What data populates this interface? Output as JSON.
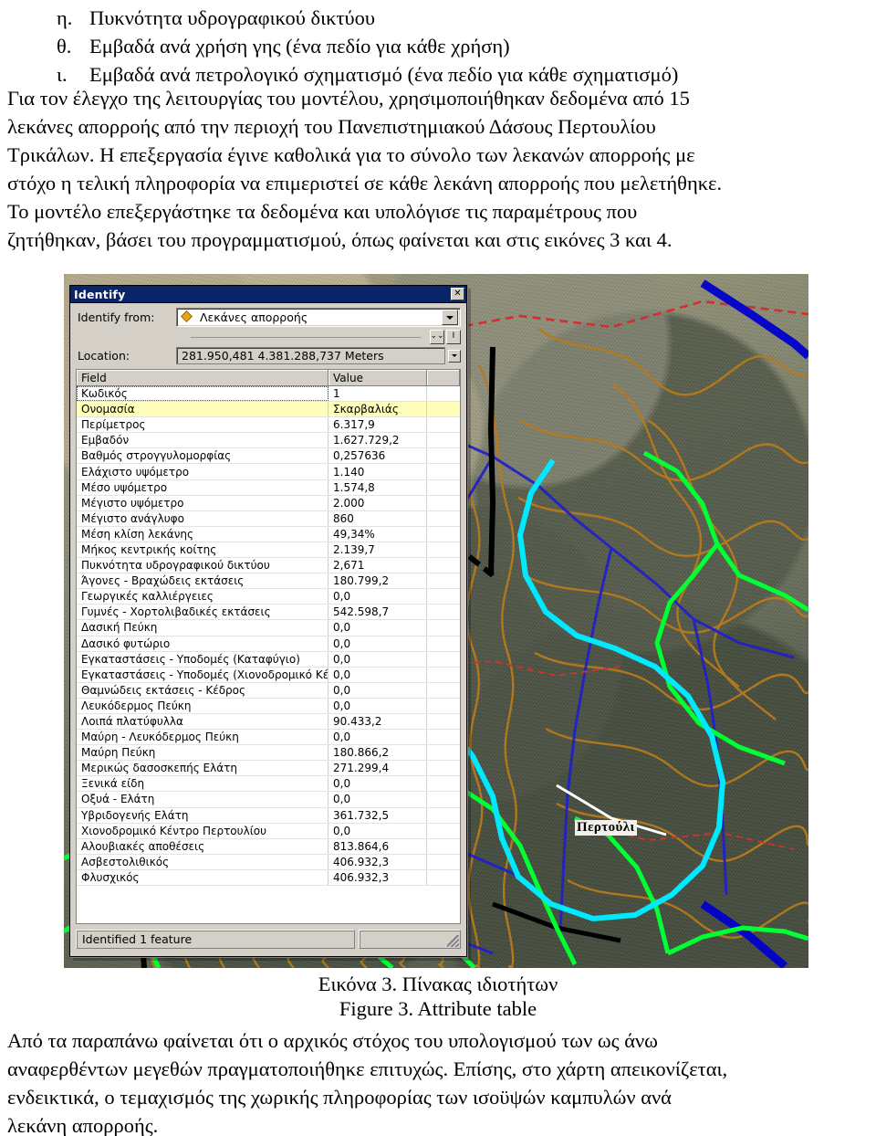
{
  "document": {
    "list_items": [
      {
        "marker": "η.",
        "text": "Πυκνότητα υδρογραφικού δικτύου"
      },
      {
        "marker": "θ.",
        "text": "Εμβαδά ανά χρήση γης (ένα πεδίο για κάθε χρήση)"
      },
      {
        "marker": "ι.",
        "text": "Εμβαδά ανά πετρολογικό σχηματισμό (ένα πεδίο για κάθε σχηματισμό)"
      }
    ],
    "paragraph_top_lines": [
      "Για τον έλεγχο της λειτουργίας του μοντέλου, χρησιμοποιήθηκαν δεδομένα από 15",
      "λεκάνες απορροής από την περιοχή του Πανεπιστημιακού Δάσους Περτουλίου",
      "Τρικάλων. Η επεξεργασία έγινε καθολικά για το σύνολο των λεκανών απορροής με",
      "στόχο η τελική πληροφορία να επιμεριστεί σε κάθε λεκάνη απορροής που μελετήθηκε.",
      "Το μοντέλο επεξεργάστηκε τα δεδομένα και υπολόγισε τις παραμέτρους που",
      "ζητήθηκαν, βάσει του προγραμματισμού, όπως φαίνεται και στις εικόνες 3 και 4."
    ],
    "caption_greek": "Εικόνα 3. Πίνακας ιδιοτήτων",
    "caption_english": "Figure 3. Attribute table",
    "paragraph_bottom_lines": [
      "Από τα παραπάνω φαίνεται ότι ο αρχικός στόχος του υπολογισμού των ως άνω",
      "αναφερθέντων μεγεθών πραγματοποιήθηκε επιτυχώς. Επίσης, στο χάρτη απεικονίζεται,",
      "ενδεικτικά, ο τεμαχισμός της χωρικής πληροφορίας των ισοϋψών καμπυλών ανά",
      "λεκάνη απορροής."
    ]
  },
  "map": {
    "label": "Περτούλι",
    "colors": {
      "contour": "#b8791a",
      "stream": "#2020c8",
      "basin_outline": "#00ff33",
      "selected_basin": "#00eaff",
      "road_black": "#000000",
      "road_red": "#d03030",
      "water_blue": "#0000cc"
    }
  },
  "dialog": {
    "title": "Identify",
    "close_label": "✕",
    "identify_from_label": "Identify from:",
    "identify_from_value": "Λεκάνες απορροής",
    "expand_button_label": "⌄⌄",
    "info_button_label": "I",
    "location_label": "Location:",
    "location_value": "281.950,481  4.381.288,737 Meters",
    "columns": [
      "Field",
      "Value",
      ""
    ],
    "rows": [
      {
        "field": "Κωδικός",
        "value": "1",
        "state": "selected"
      },
      {
        "field": "Ονομασία",
        "value": "Σκαρβαλιάς",
        "state": "highlight"
      },
      {
        "field": "Περίμετρος",
        "value": "6.317,9",
        "state": ""
      },
      {
        "field": "Εμβαδόν",
        "value": "1.627.729,2",
        "state": ""
      },
      {
        "field": "Βαθμός στρογγυλομορφίας",
        "value": "0,257636",
        "state": ""
      },
      {
        "field": "Ελάχιστο υψόμετρο",
        "value": "1.140",
        "state": ""
      },
      {
        "field": "Μέσο υψόμετρο",
        "value": "1.574,8",
        "state": ""
      },
      {
        "field": "Μέγιστο υψόμετρο",
        "value": "2.000",
        "state": ""
      },
      {
        "field": "Μέγιστο ανάγλυφο",
        "value": "860",
        "state": ""
      },
      {
        "field": "Μέση κλίση λεκάνης",
        "value": "49,34%",
        "state": ""
      },
      {
        "field": "Μήκος κεντρικής κοίτης",
        "value": "2.139,7",
        "state": ""
      },
      {
        "field": "Πυκνότητα υδρογραφικού δικτύου",
        "value": "2,671",
        "state": ""
      },
      {
        "field": "Άγονες - Βραχώδεις εκτάσεις",
        "value": "180.799,2",
        "state": ""
      },
      {
        "field": "Γεωργικές καλλιέργειες",
        "value": "0,0",
        "state": ""
      },
      {
        "field": "Γυμνές - Χορτολιβαδικές εκτάσεις",
        "value": "542.598,7",
        "state": ""
      },
      {
        "field": "Δασική Πεύκη",
        "value": "0,0",
        "state": ""
      },
      {
        "field": "Δασικό φυτώριο",
        "value": "0,0",
        "state": ""
      },
      {
        "field": "Εγκαταστάσεις - Υποδομές (Καταφύγιο)",
        "value": "0,0",
        "state": ""
      },
      {
        "field": "Εγκαταστάσεις - Υποδομές (Χιονοδρομικό Κέντρο)",
        "value": "0,0",
        "state": ""
      },
      {
        "field": "Θαμνώδεις εκτάσεις - Κέδρος",
        "value": "0,0",
        "state": ""
      },
      {
        "field": "Λευκόδερμος Πεύκη",
        "value": "0,0",
        "state": ""
      },
      {
        "field": "Λοιπά πλατύφυλλα",
        "value": "90.433,2",
        "state": ""
      },
      {
        "field": "Μαύρη - Λευκόδερμος Πεύκη",
        "value": "0,0",
        "state": ""
      },
      {
        "field": "Μαύρη Πεύκη",
        "value": "180.866,2",
        "state": ""
      },
      {
        "field": "Μερικώς δασοσκεπής Ελάτη",
        "value": "271.299,4",
        "state": ""
      },
      {
        "field": "Ξενικά είδη",
        "value": "0,0",
        "state": ""
      },
      {
        "field": "Οξυά - Ελάτη",
        "value": "0,0",
        "state": ""
      },
      {
        "field": "Υβριδογενής Ελάτη",
        "value": "361.732,5",
        "state": ""
      },
      {
        "field": "Χιονοδρομικό Κέντρο Περτουλίου",
        "value": "0,0",
        "state": ""
      },
      {
        "field": "Αλουβιακές αποθέσεις",
        "value": "813.864,6",
        "state": ""
      },
      {
        "field": "Ασβεστολιθικός",
        "value": "406.932,3",
        "state": ""
      },
      {
        "field": "Φλυσχικός",
        "value": "406.932,3",
        "state": ""
      }
    ],
    "status_text": "Identified 1 feature"
  }
}
